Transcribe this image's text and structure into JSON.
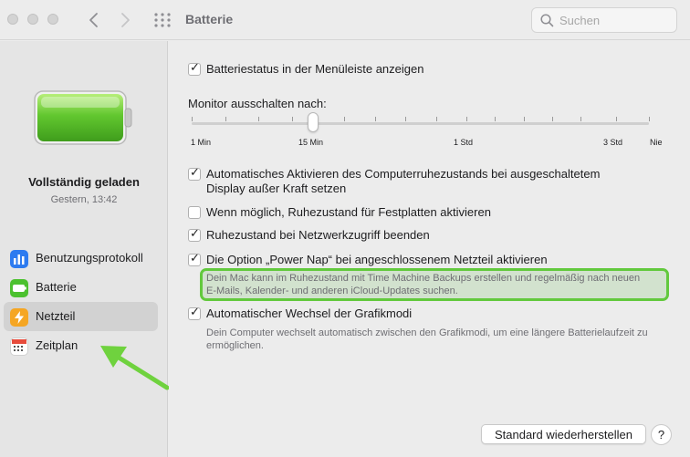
{
  "window": {
    "title": "Batterie"
  },
  "search": {
    "placeholder": "Suchen"
  },
  "sidebar": {
    "status": "Vollständig geladen",
    "time": "Gestern, 13:42",
    "items": [
      {
        "label": "Benutzungsprotokoll",
        "icon": "usage-history-icon",
        "color": "#2d7bf0"
      },
      {
        "label": "Batterie",
        "icon": "battery-icon",
        "color": "#4cc12f"
      },
      {
        "label": "Netzteil",
        "icon": "power-adapter-icon",
        "color": "#f5a623",
        "selected": true
      },
      {
        "label": "Zeitplan",
        "icon": "calendar-icon",
        "color": "#e74c3c"
      }
    ]
  },
  "main": {
    "option_menu_status": {
      "label": "Batteriestatus in der Menüleiste anzeigen",
      "checked": true
    },
    "monitor": {
      "label": "Monitor ausschalten nach:",
      "ticks": [
        "1 Min",
        "15 Min",
        "1 Std",
        "3 Std",
        "Nie"
      ],
      "value": "15 Min"
    },
    "option_auto_sleep": {
      "line1": "Automatisches Aktivieren des Computerruhezustands bei ausgeschaltetem",
      "line2": "Display außer Kraft setzen",
      "checked": true
    },
    "option_disk_sleep": {
      "label": "Wenn möglich, Ruhezustand für Festplatten aktivieren",
      "checked": false
    },
    "option_network_wake": {
      "label": "Ruhezustand bei Netzwerkzugriff beenden",
      "checked": true
    },
    "option_power_nap": {
      "label": "Die Option „Power Nap“ bei angeschlossenem Netzteil aktivieren",
      "checked": true,
      "desc1": "Dein Mac kann im Ruhezustand mit Time Machine Backups erstellen und regelmäßig nach neuen",
      "desc2": "E-Mails, Kalender- und anderen iCloud-Updates suchen."
    },
    "option_gpu": {
      "label": "Automatischer Wechsel der Grafikmodi",
      "checked": true,
      "desc1": "Dein Computer wechselt automatisch zwischen den Grafikmodi, um eine längere Batterielaufzeit zu",
      "desc2": "ermöglichen."
    },
    "restore_button": "Standard wiederherstellen",
    "help_button": "?"
  },
  "colors": {
    "highlight": "#62c93d",
    "arrow": "#6fd23e",
    "battery": "#5ac42f"
  }
}
